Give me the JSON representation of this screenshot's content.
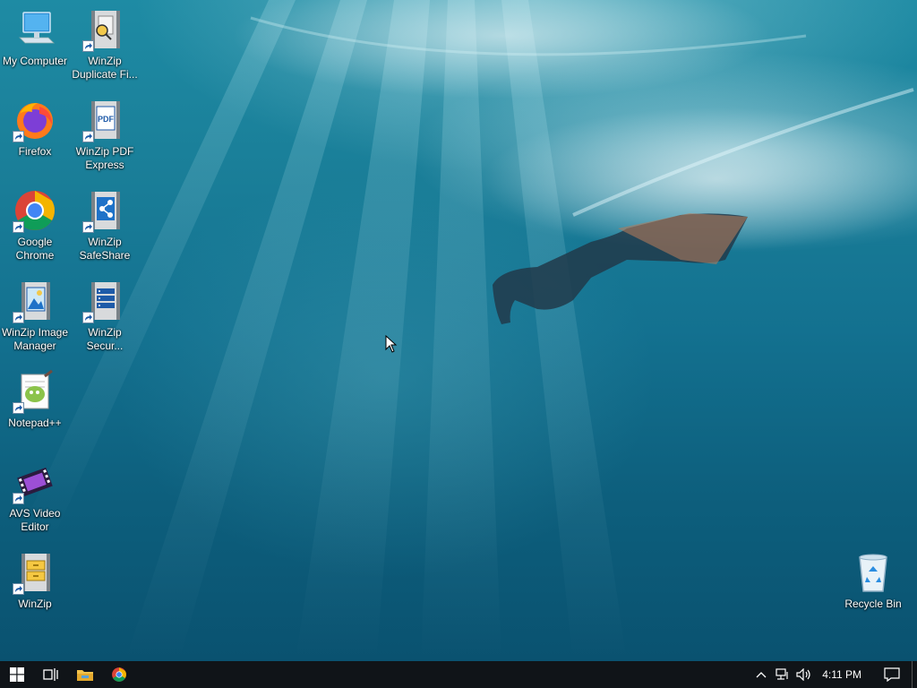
{
  "desktop": {
    "icons": [
      {
        "label": "My Computer",
        "icon": "computer-icon"
      },
      {
        "label": "WinZip Duplicate Fi...",
        "icon": "winzip-duplicate-finder-icon"
      },
      {
        "label": "Firefox",
        "icon": "firefox-icon"
      },
      {
        "label": "WinZip PDF Express",
        "icon": "winzip-pdf-express-icon"
      },
      {
        "label": "Google Chrome",
        "icon": "chrome-icon"
      },
      {
        "label": "WinZip SafeShare",
        "icon": "winzip-safeshare-icon"
      },
      {
        "label": "WinZip Image Manager",
        "icon": "winzip-image-manager-icon"
      },
      {
        "label": "WinZip Secur...",
        "icon": "winzip-secure-backup-icon"
      },
      {
        "label": "Notepad++",
        "icon": "notepad-plus-plus-icon"
      },
      {
        "label": "AVS Video Editor",
        "icon": "avs-video-editor-icon"
      },
      {
        "label": "WinZip",
        "icon": "winzip-icon"
      },
      {
        "label": "Recycle Bin",
        "icon": "recycle-bin-icon"
      }
    ],
    "wallpaper": "underwater swimmer with fins"
  },
  "taskbar": {
    "pinned": [
      {
        "name": "start-button",
        "icon": "windows-logo-icon"
      },
      {
        "name": "task-view-button",
        "icon": "task-view-icon"
      },
      {
        "name": "file-explorer-button",
        "icon": "folder-icon"
      },
      {
        "name": "chrome-taskbar-button",
        "icon": "chrome-icon"
      }
    ],
    "tray": {
      "icons": [
        "chevron-up-icon",
        "network-icon",
        "volume-icon"
      ],
      "clock": "4:11 PM",
      "notification_icon": "action-center-icon"
    }
  },
  "colors": {
    "taskbar_bg": "#101418",
    "water_top": "#1e8ba4",
    "water_bottom": "#0a5270"
  }
}
